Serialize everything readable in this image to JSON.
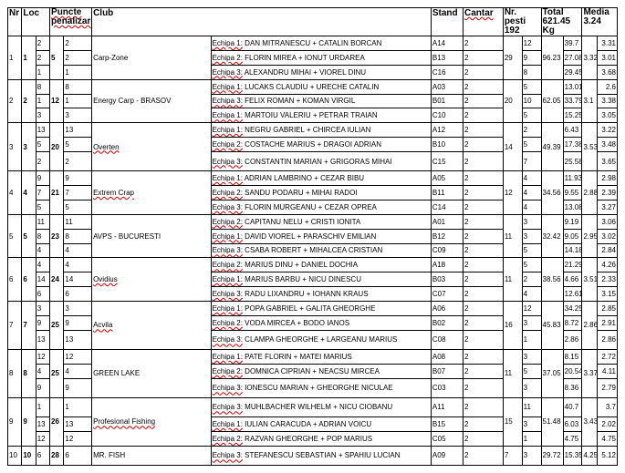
{
  "headers": {
    "nr": "Nr",
    "loc": "Loc",
    "puncte": "Puncte penalizare",
    "club": "Club",
    "stand": "Stand",
    "cantar": "Cantar",
    "pesti": "Nr. pesti 192",
    "total": "Total 621.45 Kg",
    "media": "Media 3.24"
  },
  "clubs": [
    {
      "nr": "1",
      "loc": "1",
      "pts": "5",
      "name": "Carp-Zone",
      "pesti": "29",
      "total": "96.23",
      "media": "3.32",
      "teams": [
        {
          "a": "2",
          "b": "2",
          "echipa": "Echipa 1:",
          "members": "DAN MITRANESCU + CATALIN BORCAN",
          "stand": "A14",
          "cantar": "2",
          "pesti": "12",
          "kg": "39.7",
          "med": "3.31"
        },
        {
          "a": "2",
          "b": "2",
          "echipa": "Echipa 2:",
          "members": "FLORIN MIREA + IONUT URDAREA",
          "stand": "B13",
          "cantar": "2",
          "pesti": "9",
          "kg": "27.08",
          "med": "3.01"
        },
        {
          "a": "1",
          "b": "1",
          "echipa": "Echipa 3:",
          "members": "ALEXANDRU MIHAI + VIOREL DINU",
          "stand": "C16",
          "cantar": "2",
          "pesti": "8",
          "kg": "29.45",
          "med": "3.68"
        }
      ]
    },
    {
      "nr": "2",
      "loc": "2",
      "pts": "12",
      "name": "Energy Carp - BRASOV",
      "pesti": "20",
      "total": "62.05",
      "media": "3.1",
      "teams": [
        {
          "a": "8",
          "b": "8",
          "echipa": "Echipa 1:",
          "members": "LUCAKS CLAUDIU + URECHE CATALIN",
          "stand": "A03",
          "cantar": "2",
          "pesti": "5",
          "kg": "13.01",
          "med": "2.6"
        },
        {
          "a": "1",
          "b": "1",
          "echipa": "Echipa 3:",
          "members": "FELIX ROMAN + KOMAN VIRGIL",
          "stand": "B01",
          "cantar": "2",
          "pesti": "10",
          "kg": "33.79",
          "med": "3.38"
        },
        {
          "a": "3",
          "b": "3",
          "echipa": "Echipa 1:",
          "members": "MARTOIU VALERIU + PETRAR TRAIAN",
          "stand": "C10",
          "cantar": "2",
          "pesti": "5",
          "kg": "15.25",
          "med": "3.05"
        }
      ]
    },
    {
      "nr": "3",
      "loc": "3",
      "pts": "20",
      "name": "Overten",
      "pesti": "14",
      "total": "49.39",
      "media": "3.53",
      "teams": [
        {
          "a": "13",
          "b": "13",
          "echipa": "Echipa 1:",
          "members": "NEGRU GABRIEL + CHIRCEA IULIAN",
          "stand": "A12",
          "cantar": "2",
          "pesti": "2",
          "kg": "6.43",
          "med": "3.22"
        },
        {
          "a": "5",
          "b": "5",
          "echipa": "Echipa 2:",
          "members": "COSTACHE MARIUS + DRAGOI ADRIAN",
          "stand": "B10",
          "cantar": "2",
          "pesti": "5",
          "kg": "17.38",
          "med": "3.48"
        },
        {
          "a": "2",
          "b": "2",
          "echipa": "Echipa 3:",
          "members": "CONSTANTIN MARIAN + GRIGORAS MIHAI",
          "stand": "C15",
          "cantar": "2",
          "pesti": "7",
          "kg": "25.58",
          "med": "3.65"
        }
      ]
    },
    {
      "nr": "4",
      "loc": "4",
      "pts": "21",
      "name": "Extrem Crap",
      "pesti": "12",
      "total": "34.56",
      "media": "2.88",
      "teams": [
        {
          "a": "9",
          "b": "9",
          "echipa": "Echipa 1:",
          "members": "ADRIAN LAMBRINO + CEZAR BIBU",
          "stand": "A05",
          "cantar": "2",
          "pesti": "4",
          "kg": "11.93",
          "med": "2.98"
        },
        {
          "a": "7",
          "b": "7",
          "echipa": "Echipa 2:",
          "members": "SANDU PODARU + MIHAI RADOI",
          "stand": "B11",
          "cantar": "2",
          "pesti": "4",
          "kg": "9.55",
          "med": "2.39"
        },
        {
          "a": "5",
          "b": "5",
          "echipa": "Echipa 3:",
          "members": "FLORIN MURGEANU + CEZAR OPREA",
          "stand": "C14",
          "cantar": "2",
          "pesti": "4",
          "kg": "13.08",
          "med": "3.27"
        }
      ]
    },
    {
      "nr": "5",
      "loc": "5",
      "pts": "23",
      "name": "AVPS - BUCURESTI",
      "pesti": "11",
      "total": "32.42",
      "media": "2.95",
      "teams": [
        {
          "a": "11",
          "b": "11",
          "echipa": "Echipa 2:",
          "members": "CAPITANU NELU + CRISTI IONITA",
          "stand": "A01",
          "cantar": "2",
          "pesti": "3",
          "kg": "9.19",
          "med": "3.06"
        },
        {
          "a": "8",
          "b": "8",
          "echipa": "Echipa 1:",
          "members": "DAVID VIOREL + PARASCHIV EMILIAN",
          "stand": "B12",
          "cantar": "2",
          "pesti": "3",
          "kg": "9.05",
          "med": "3.02"
        },
        {
          "a": "4",
          "b": "4",
          "echipa": "Echipa 3:",
          "members": "CSABA ROBERT + MIHALCEA CRISTIAN",
          "stand": "C09",
          "cantar": "2",
          "pesti": "5",
          "kg": "14.18",
          "med": "2.84"
        }
      ]
    },
    {
      "nr": "6",
      "loc": "6",
      "pts": "24",
      "name": "Ovidius",
      "pesti": "11",
      "total": "38.56",
      "media": "3.51",
      "teams": [
        {
          "a": "4",
          "b": "4",
          "echipa": "Echipa 2:",
          "members": "MARIUS DINU + DANIEL DOCHIA",
          "stand": "A18",
          "cantar": "2",
          "pesti": "5",
          "kg": "21.29",
          "med": "4.26"
        },
        {
          "a": "14",
          "b": "14",
          "echipa": "Echipa 1:",
          "members": "MARIUS BARBU + NICU DINESCU",
          "stand": "B03",
          "cantar": "2",
          "pesti": "2",
          "kg": "4.66",
          "med": "2.33"
        },
        {
          "a": "6",
          "b": "6",
          "echipa": "Echipa 3:",
          "members": "RADU LIXANDRU + IOHANN KRAUS",
          "stand": "C07",
          "cantar": "2",
          "pesti": "4",
          "kg": "12.61",
          "med": "3.15"
        }
      ]
    },
    {
      "nr": "7",
      "loc": "7",
      "pts": "25",
      "name": "Acvila",
      "pesti": "16",
      "total": "45.83",
      "media": "2.86",
      "teams": [
        {
          "a": "3",
          "b": "3",
          "echipa": "Echipa 1:",
          "members": "POPA GABRIEL + GALITA GHEORGHE",
          "stand": "A06",
          "cantar": "2",
          "pesti": "12",
          "kg": "34.25",
          "med": "2.85"
        },
        {
          "a": "9",
          "b": "9",
          "echipa": "Echipa 2:",
          "members": "VODA MIRCEA + BODO IANOS",
          "stand": "B02",
          "cantar": "2",
          "pesti": "3",
          "kg": "8.72",
          "med": "2.91"
        },
        {
          "a": "13",
          "b": "13",
          "echipa": "Echipa 3:",
          "members": "CLAMPA GHEORGHE + LARGEANU MARIUS",
          "stand": "C08",
          "cantar": "2",
          "pesti": "1",
          "kg": "2.86",
          "med": "2.86"
        }
      ]
    },
    {
      "nr": "8",
      "loc": "8",
      "pts": "25",
      "name": "GREEN LAKE",
      "pesti": "11",
      "total": "37.05",
      "media": "3.37",
      "teams": [
        {
          "a": "12",
          "b": "12",
          "echipa": "Echipa 1:",
          "members": "PATE FLORIN + MATEI MARIUS",
          "stand": "A08",
          "cantar": "2",
          "pesti": "3",
          "kg": "8.15",
          "med": "2.72"
        },
        {
          "a": "4",
          "b": "4",
          "echipa": "Echipa 2:",
          "members": "DOMNICA CIPRIAN + NEACSU MIRCEA",
          "stand": "B07",
          "cantar": "2",
          "pesti": "5",
          "kg": "20.54",
          "med": "4.11"
        },
        {
          "a": "9",
          "b": "9",
          "echipa": "Echipa 3:",
          "members": "IONESCU MARIAN + GHEORGHE NICULAE",
          "stand": "C03",
          "cantar": "2",
          "pesti": "3",
          "kg": "8.36",
          "med": "2.79"
        }
      ]
    },
    {
      "nr": "9",
      "loc": "9",
      "pts": "26",
      "name": "Profesional Fishing",
      "pesti": "15",
      "total": "51.48",
      "media": "3.43",
      "teams": [
        {
          "a": "1",
          "b": "1",
          "echipa": "Echipa 3:",
          "members": "MUHLBACHER WILHELM + NICU CIOBANU",
          "stand": "A11",
          "cantar": "2",
          "pesti": "11",
          "kg": "40.7",
          "med": "3.7"
        },
        {
          "a": "13",
          "b": "13",
          "echipa": "Echipa 1:",
          "members": "IULIAN CARACUDA + ADRIAN VOICU",
          "stand": "B15",
          "cantar": "2",
          "pesti": "3",
          "kg": "6.03",
          "med": "2.02"
        },
        {
          "a": "12",
          "b": "12",
          "echipa": "Echipa 2:",
          "members": "RAZVAN GHEORGHE + POP MARIUS",
          "stand": "C05",
          "cantar": "2",
          "pesti": "1",
          "kg": "4.75",
          "med": "4.75"
        }
      ]
    },
    {
      "nr": "10",
      "loc": "10",
      "pts": "28",
      "name": "MR. FISH",
      "pesti": "7",
      "total": "29.72",
      "media": "4.25",
      "teams": [
        {
          "a": "6",
          "b": "6",
          "echipa": "Echipa 3:",
          "members": "STEFANESCU SEBASTIAN + SPAHIU LUCIAN",
          "stand": "A09",
          "cantar": "2",
          "pesti": "3",
          "kg": "15.35",
          "med": "5.12"
        }
      ]
    }
  ]
}
